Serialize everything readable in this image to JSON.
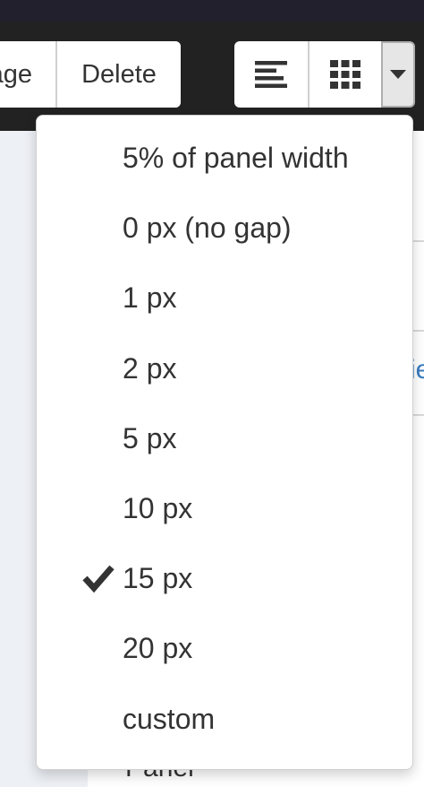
{
  "toolbar": {
    "manage_label": "age",
    "delete_label": "Delete",
    "icons": [
      "align-left-icon",
      "grid-icon",
      "caret-down-icon"
    ]
  },
  "dropdown": {
    "items": [
      {
        "label": "5% of panel width",
        "selected": false
      },
      {
        "label": "0 px (no gap)",
        "selected": false
      },
      {
        "label": "1 px",
        "selected": false
      },
      {
        "label": "2 px",
        "selected": false
      },
      {
        "label": "5 px",
        "selected": false
      },
      {
        "label": "10 px",
        "selected": false
      },
      {
        "label": "15 px",
        "selected": true
      },
      {
        "label": "20 px",
        "selected": false
      },
      {
        "label": "custom",
        "selected": false
      }
    ]
  },
  "background": {
    "link_fragment": "ie",
    "panel_fragment": "Panel"
  },
  "colors": {
    "toolbar_bg": "#222222",
    "top_strip": "#23202e",
    "link": "#3a7cbf",
    "text": "#333333"
  }
}
